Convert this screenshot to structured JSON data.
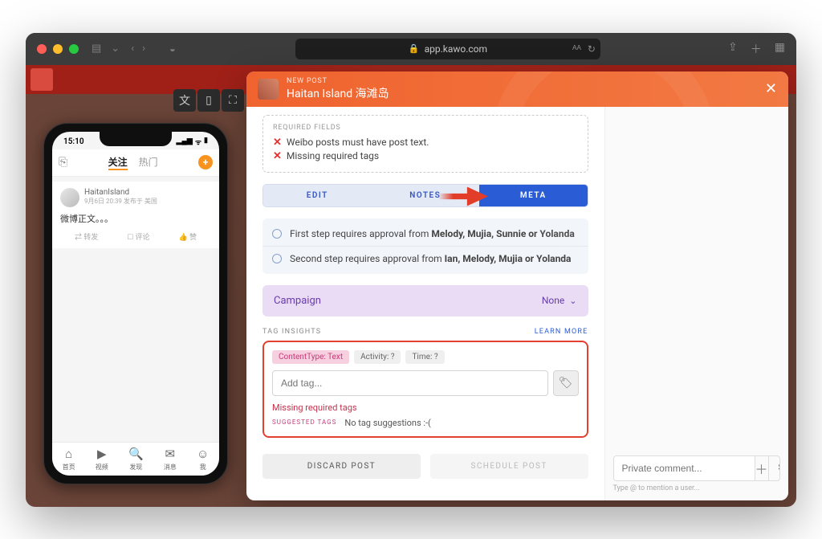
{
  "browser": {
    "url": "app.kawo.com"
  },
  "phone": {
    "time": "15:10",
    "tabs": {
      "follow": "关注",
      "hot": "热门"
    },
    "post": {
      "author": "HaitanIsland",
      "meta": "9月6日 20:39 发布于 美国",
      "body": "微博正文。。。",
      "actions": {
        "repost": "转发",
        "comment": "评论",
        "like": "赞"
      }
    },
    "tabbar": {
      "home": "首页",
      "video": "视频",
      "discover": "发现",
      "msg": "消息",
      "me": "我"
    }
  },
  "modal": {
    "subtitle": "NEW POST",
    "title": "Haitan Island 海滩岛",
    "required": {
      "label": "REQUIRED FIELDS",
      "item1": "Weibo posts must have post text.",
      "item2": "Missing required tags"
    },
    "tabs": {
      "edit": "EDIT",
      "notes": "NOTES",
      "meta": "META"
    },
    "approval": {
      "step1_prefix": "First step requires approval from ",
      "step1_names": "Melody, Mujia, Sunnie or Yolanda",
      "step2_prefix": "Second step requires approval from ",
      "step2_names": "Ian, Melody, Mujia or Yolanda"
    },
    "campaign": {
      "label": "Campaign",
      "value": "None"
    },
    "tags": {
      "label": "TAG INSIGHTS",
      "learn": "LEARN MORE",
      "chip_content": "ContentType: Text",
      "chip_activity": "Activity: ?",
      "chip_time": "Time: ?",
      "placeholder": "Add tag...",
      "missing": "Missing required tags",
      "suggested_label": "SUGGESTED TAGS",
      "suggested_text": "No tag suggestions :-("
    },
    "buttons": {
      "discard": "DISCARD POST",
      "schedule": "SCHEDULE POST"
    }
  },
  "comment": {
    "placeholder": "Private comment...",
    "send": "SEND",
    "hint": "Type @ to mention a user..."
  }
}
